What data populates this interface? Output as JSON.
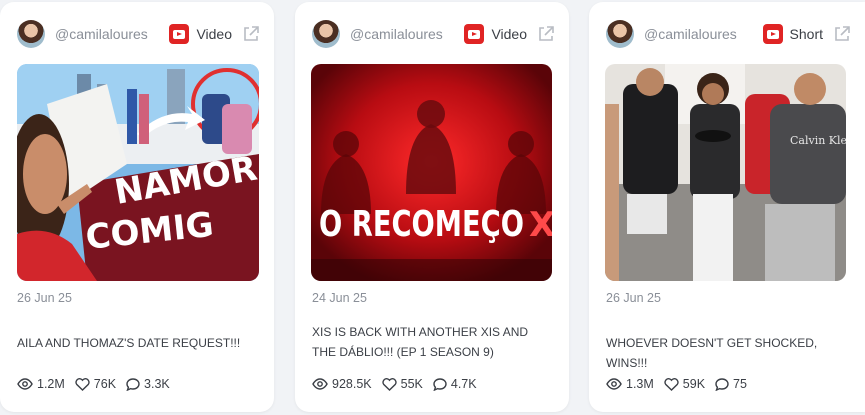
{
  "cards": [
    {
      "handle": "@camilaloures",
      "type": "Video",
      "date": "26 Jun 25",
      "title": "AILA AND THOMAZ'S DATE REQUEST!!!",
      "thumbnail_text": [
        "NAMOR",
        "COMIG"
      ],
      "views": "1.2M",
      "likes": "76K",
      "comments": "3.3K"
    },
    {
      "handle": "@camilaloures",
      "type": "Video",
      "date": "24 Jun 25",
      "title": "XIS IS BACK WITH ANOTHER XIS AND THE DÁBLIO!!! (EP 1 SEASON 9)",
      "thumbnail_text": [
        "O RECOMEÇO",
        "X"
      ],
      "views": "928.5K",
      "likes": "55K",
      "comments": "4.7K"
    },
    {
      "handle": "@camilaloures",
      "type": "Short",
      "date": "26 Jun 25",
      "title": "WHOEVER DOESN'T GET SHOCKED, WINS!!!",
      "thumbnail_text": [
        "Calvin Klein"
      ],
      "views": "1.3M",
      "likes": "59K",
      "comments": "75"
    }
  ],
  "colors": {
    "accent": "#e02424",
    "muted": "#8a8f98",
    "text": "#3b3f46"
  },
  "icons": {
    "platform": "youtube-icon",
    "open": "external-link-icon",
    "views": "eye-icon",
    "likes": "heart-icon",
    "comments": "comment-icon"
  }
}
